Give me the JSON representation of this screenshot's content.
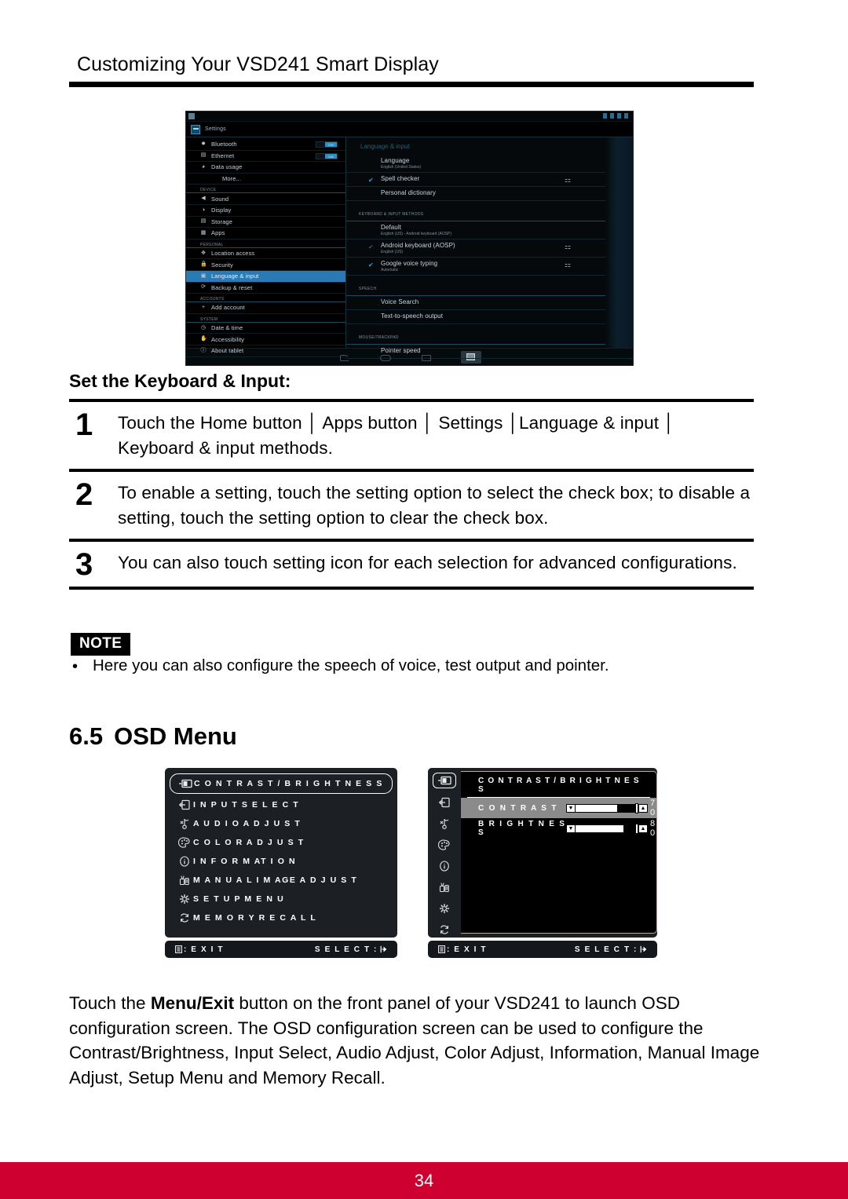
{
  "header": {
    "title": "Customizing Your VSD241 Smart Display"
  },
  "tablet": {
    "app_title": "Settings",
    "sidebar": [
      {
        "type": "item",
        "icon": "bluetooth-icon",
        "label": "Bluetooth",
        "toggle": "ON"
      },
      {
        "type": "item",
        "icon": "ethernet-icon",
        "label": "Ethernet",
        "toggle": "ON"
      },
      {
        "type": "item",
        "icon": "data-usage-icon",
        "label": "Data usage"
      },
      {
        "type": "item",
        "icon": "more-icon",
        "label": "More..."
      },
      {
        "type": "header",
        "label": "DEVICE"
      },
      {
        "type": "item",
        "icon": "sound-icon",
        "label": "Sound"
      },
      {
        "type": "item",
        "icon": "display-icon",
        "label": "Display"
      },
      {
        "type": "item",
        "icon": "storage-icon",
        "label": "Storage"
      },
      {
        "type": "item",
        "icon": "apps-icon",
        "label": "Apps"
      },
      {
        "type": "header",
        "label": "PERSONAL"
      },
      {
        "type": "item",
        "icon": "location-icon",
        "label": "Location access"
      },
      {
        "type": "item",
        "icon": "security-icon",
        "label": "Security"
      },
      {
        "type": "item",
        "icon": "language-icon",
        "label": "Language & input",
        "selected": true
      },
      {
        "type": "item",
        "icon": "backup-icon",
        "label": "Backup & reset"
      },
      {
        "type": "header",
        "label": "ACCOUNTS"
      },
      {
        "type": "item",
        "icon": "add-account-icon",
        "label": "Add account"
      },
      {
        "type": "header",
        "label": "SYSTEM"
      },
      {
        "type": "item",
        "icon": "date-time-icon",
        "label": "Date & time"
      },
      {
        "type": "item",
        "icon": "accessibility-icon",
        "label": "Accessibility"
      },
      {
        "type": "item",
        "icon": "about-tablet-icon",
        "label": "About tablet"
      }
    ],
    "detail": {
      "title": "Language & input",
      "rows": [
        {
          "type": "row",
          "label": "Language",
          "sub": "English (United States)"
        },
        {
          "type": "row",
          "label": "Spell checker",
          "checked": true,
          "gear": true
        },
        {
          "type": "row",
          "label": "Personal dictionary"
        },
        {
          "type": "header",
          "label": "KEYBOARD & INPUT METHODS"
        },
        {
          "type": "row",
          "label": "Default",
          "sub": "English (US) - Android keyboard (AOSP)"
        },
        {
          "type": "row",
          "label": "Android keyboard (AOSP)",
          "sub": "English (US)",
          "checked": "dim",
          "gear": true
        },
        {
          "type": "row",
          "label": "Google voice typing",
          "sub": "Automatic",
          "checked": true,
          "gear": true
        },
        {
          "type": "header",
          "label": "SPEECH"
        },
        {
          "type": "row",
          "label": "Voice Search"
        },
        {
          "type": "row",
          "label": "Text-to-speech output"
        },
        {
          "type": "header",
          "label": "MOUSE/TRACKPAD"
        },
        {
          "type": "row",
          "label": "Pointer speed"
        }
      ]
    },
    "navbar": [
      "back-icon",
      "home-icon",
      "recent-apps-icon",
      "screenshot-icon"
    ]
  },
  "section": {
    "title": "Set the Keyboard & Input:",
    "steps": [
      {
        "num": "1",
        "text": "Touch the Home button │ Apps button │ Settings │Language & input │ Keyboard & input methods."
      },
      {
        "num": "2",
        "text": "To enable a setting, touch the setting option to select the check box; to disable a setting, touch the setting option to clear the check box."
      },
      {
        "num": "3",
        "text": "You can also touch setting icon for each selection for advanced configurations."
      }
    ]
  },
  "note": {
    "badge": "NOTE",
    "bullet": "•",
    "text": "Here you can also configure the speech of voice, test output and pointer."
  },
  "osd_heading": {
    "number": "6.5",
    "title": "OSD Menu"
  },
  "osd_left": {
    "items": [
      {
        "icon": "contrast-brightness-icon",
        "label": "C O N T R A S T / B R I G H T N E S S",
        "selected": true
      },
      {
        "icon": "input-select-icon",
        "label": "I N P U T   S E L E C T"
      },
      {
        "icon": "audio-adjust-icon",
        "label": "A U D I O   A D J U S T"
      },
      {
        "icon": "color-adjust-icon",
        "label": "C O L O R   A D J U S T"
      },
      {
        "icon": "information-icon",
        "label": "I N F O R M AT I O N"
      },
      {
        "icon": "manual-image-adjust-icon",
        "label": "M A N U A L   I M AGE   A D J U S T"
      },
      {
        "icon": "setup-menu-icon",
        "label": "S E T U P   M E N U"
      },
      {
        "icon": "memory-recall-icon",
        "label": "M E M O R Y  R E C A L L"
      }
    ],
    "bar": {
      "exit": ": E X I T",
      "select": "S E L E C T :"
    }
  },
  "osd_right": {
    "heading": "C O N T R A S T / B R I G H T N E S S",
    "rows": [
      {
        "label": "C O N T R A S T",
        "value": "7 0",
        "fill": 30,
        "highlight": true
      },
      {
        "label": "B R I G H T N E S S",
        "value": "8 0",
        "fill": 20,
        "highlight": false
      }
    ],
    "rail_icons": [
      "contrast-brightness-icon",
      "input-select-icon",
      "audio-adjust-icon",
      "color-adjust-icon",
      "information-icon",
      "manual-image-adjust-icon",
      "setup-menu-icon",
      "memory-recall-icon"
    ],
    "bar": {
      "exit": ": E X I T",
      "select": "S E L E C T :"
    }
  },
  "paragraph": {
    "lead": "Touch the ",
    "bold": "Menu/Exit",
    "rest": " button on the front panel of your VSD241 to launch OSD configuration screen. The OSD configuration screen can be used to configure the Contrast/Brightness, Input Select, Audio Adjust, Color Adjust, Information, Manual Image Adjust, Setup Menu and Memory Recall."
  },
  "footer": {
    "page": "34",
    "color": "#ce0030"
  }
}
